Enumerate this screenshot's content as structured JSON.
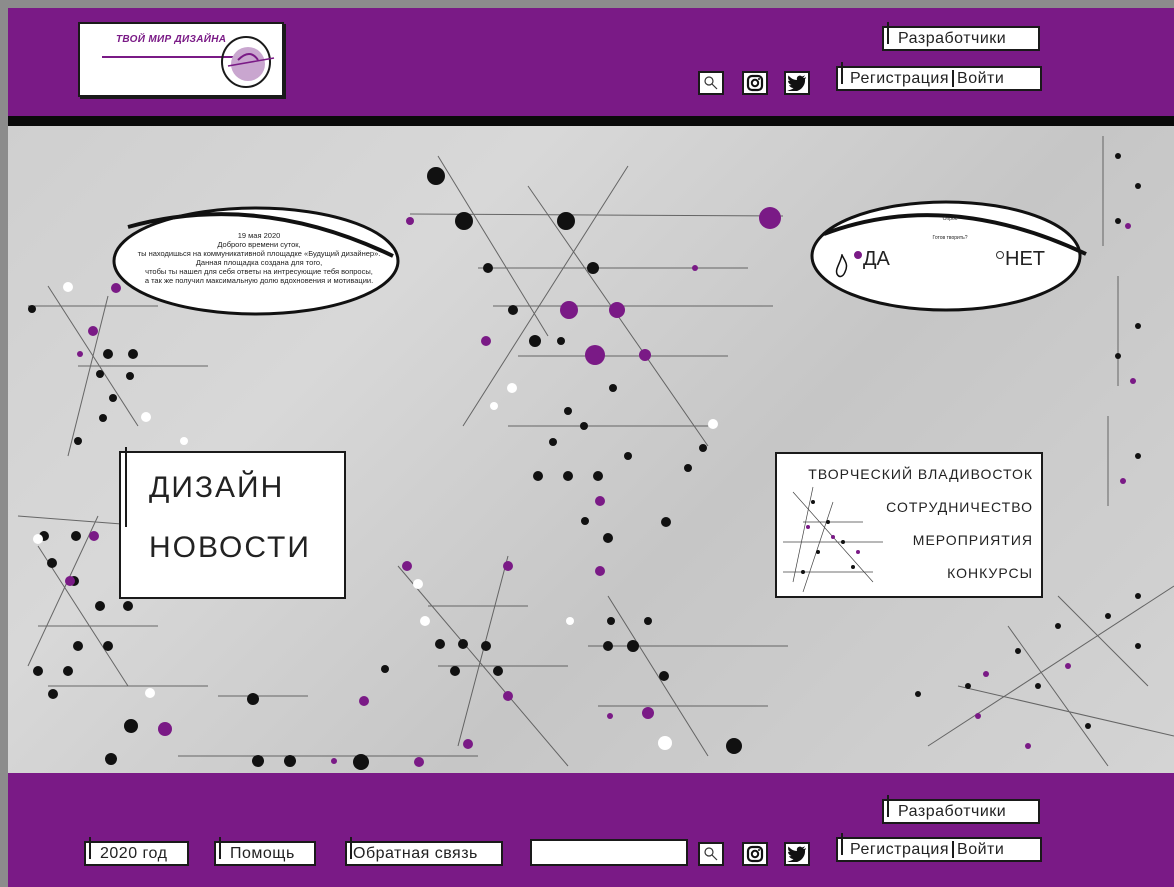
{
  "header": {
    "logo_text": "ТВОЙ МИР ДИЗАЙНА",
    "developers_label": "Разработчики",
    "register_label": "Регистрация",
    "login_label": "Войти",
    "social": [
      "search-icon",
      "instagram-icon",
      "twitter-icon"
    ]
  },
  "greeting": {
    "date": "19 мая 2020",
    "lines": [
      "Доброго времени суток,",
      "ты находишься на коммуникативной площадке «Будущий дизайнер».",
      "Данная площадка создана для того,",
      "чтобы ты нашел для себя ответы на интресующие тебя вопросы,",
      "а так же получил максимальную долю вдохновения и мотивации."
    ]
  },
  "poll": {
    "title": "Опрос",
    "question": "Готов творить?",
    "yes_label": "ДА",
    "no_label": "НЕТ",
    "selected": "yes"
  },
  "news": {
    "line1": "ДИЗАЙН",
    "line2": "НОВОСТИ"
  },
  "menu": {
    "items": [
      "ТВОРЧЕСКИЙ ВЛАДИВОСТОК",
      "СОТРУДНИЧЕСТВО",
      "МЕРОПРИЯТИЯ",
      "КОНКУРСЫ"
    ]
  },
  "footer": {
    "year_label": "2020 год",
    "help_label": "Помощь",
    "feedback_label": "Обратная связь",
    "search_value": "",
    "developers_label": "Разработчики",
    "register_label": "Регистрация",
    "login_label": "Войти"
  },
  "colors": {
    "brand": "#7a1a86",
    "accent_dot": "#8a2a94",
    "ink": "#1a1a1a"
  }
}
